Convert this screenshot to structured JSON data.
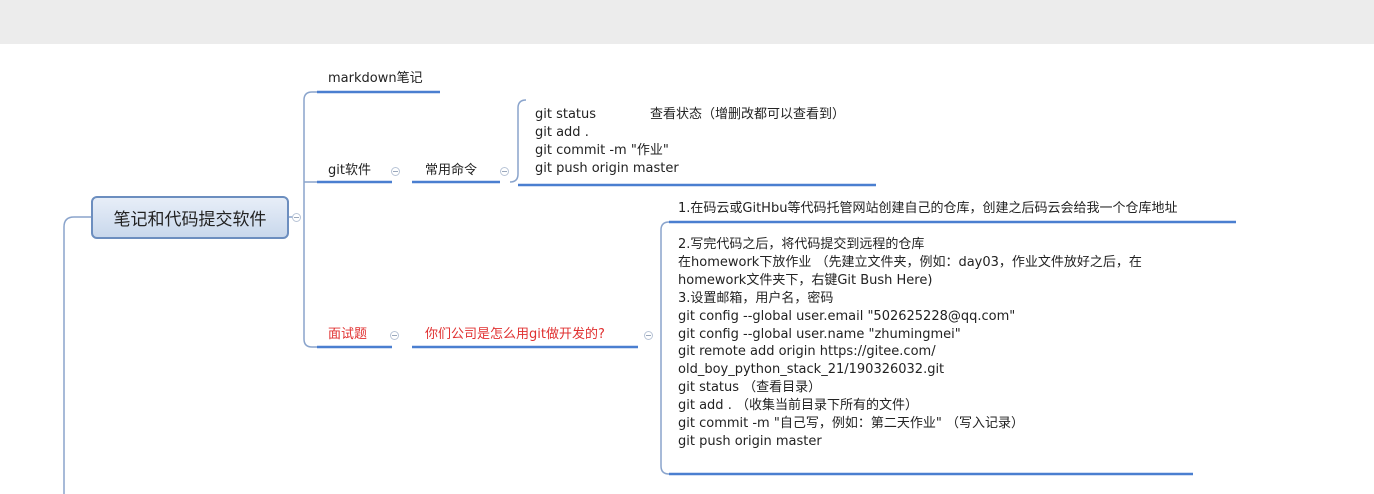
{
  "root": {
    "label": "笔记和代码提交软件"
  },
  "branches": {
    "markdown": {
      "label": "markdown笔记"
    },
    "git": {
      "label": "git软件",
      "child": {
        "label": "常用命令",
        "commands": {
          "status": "git status",
          "status_desc": "查看状态（增删改都可以查看到）",
          "add": "git add .",
          "commit": "git commit -m \"作业\"",
          "push": "git push origin master"
        }
      }
    },
    "interview": {
      "label": "面试题",
      "question": "你们公司是怎么用git做开发的?",
      "answer_step1": "1.在码云或GitHbu等代码托管网站创建自己的仓库，创建之后码云会给我一个仓库地址",
      "answer_lines": [
        "2.写完代码之后，将代码提交到远程的仓库",
        "在homework下放作业 （先建立文件夹，例如：day03，作业文件放好之后，在",
        "homework文件夹下，右键Git Bush Here)",
        "3.设置邮箱，用户名，密码",
        "git config --global user.email \"502625228@qq.com\"",
        "git config --global user.name \"zhumingmei\"",
        "git remote add origin https://gitee.com/",
        "old_boy_python_stack_21/190326032.git",
        "git status （查看目录）",
        "git add . （收集当前目录下所有的文件）",
        "git commit -m \"自己写，例如：第二天作业\"  （写入记录）",
        "git push origin master"
      ]
    }
  },
  "colors": {
    "line": "#4a7fd0",
    "connector": "#8aa4cc",
    "root_border": "#6c8ebf",
    "interview_text": "#e03030"
  }
}
